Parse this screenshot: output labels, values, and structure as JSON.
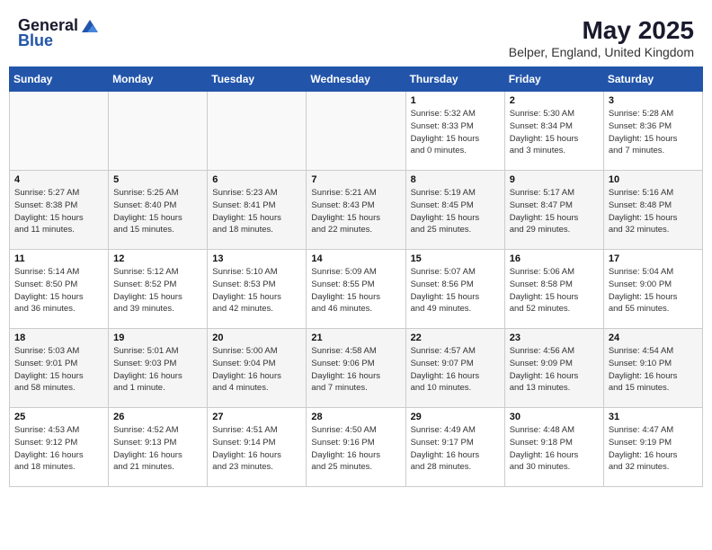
{
  "logo": {
    "general": "General",
    "blue": "Blue"
  },
  "title": "May 2025",
  "location": "Belper, England, United Kingdom",
  "days_of_week": [
    "Sunday",
    "Monday",
    "Tuesday",
    "Wednesday",
    "Thursday",
    "Friday",
    "Saturday"
  ],
  "weeks": [
    [
      {
        "day": "",
        "info": ""
      },
      {
        "day": "",
        "info": ""
      },
      {
        "day": "",
        "info": ""
      },
      {
        "day": "",
        "info": ""
      },
      {
        "day": "1",
        "info": "Sunrise: 5:32 AM\nSunset: 8:33 PM\nDaylight: 15 hours\nand 0 minutes."
      },
      {
        "day": "2",
        "info": "Sunrise: 5:30 AM\nSunset: 8:34 PM\nDaylight: 15 hours\nand 3 minutes."
      },
      {
        "day": "3",
        "info": "Sunrise: 5:28 AM\nSunset: 8:36 PM\nDaylight: 15 hours\nand 7 minutes."
      }
    ],
    [
      {
        "day": "4",
        "info": "Sunrise: 5:27 AM\nSunset: 8:38 PM\nDaylight: 15 hours\nand 11 minutes."
      },
      {
        "day": "5",
        "info": "Sunrise: 5:25 AM\nSunset: 8:40 PM\nDaylight: 15 hours\nand 15 minutes."
      },
      {
        "day": "6",
        "info": "Sunrise: 5:23 AM\nSunset: 8:41 PM\nDaylight: 15 hours\nand 18 minutes."
      },
      {
        "day": "7",
        "info": "Sunrise: 5:21 AM\nSunset: 8:43 PM\nDaylight: 15 hours\nand 22 minutes."
      },
      {
        "day": "8",
        "info": "Sunrise: 5:19 AM\nSunset: 8:45 PM\nDaylight: 15 hours\nand 25 minutes."
      },
      {
        "day": "9",
        "info": "Sunrise: 5:17 AM\nSunset: 8:47 PM\nDaylight: 15 hours\nand 29 minutes."
      },
      {
        "day": "10",
        "info": "Sunrise: 5:16 AM\nSunset: 8:48 PM\nDaylight: 15 hours\nand 32 minutes."
      }
    ],
    [
      {
        "day": "11",
        "info": "Sunrise: 5:14 AM\nSunset: 8:50 PM\nDaylight: 15 hours\nand 36 minutes."
      },
      {
        "day": "12",
        "info": "Sunrise: 5:12 AM\nSunset: 8:52 PM\nDaylight: 15 hours\nand 39 minutes."
      },
      {
        "day": "13",
        "info": "Sunrise: 5:10 AM\nSunset: 8:53 PM\nDaylight: 15 hours\nand 42 minutes."
      },
      {
        "day": "14",
        "info": "Sunrise: 5:09 AM\nSunset: 8:55 PM\nDaylight: 15 hours\nand 46 minutes."
      },
      {
        "day": "15",
        "info": "Sunrise: 5:07 AM\nSunset: 8:56 PM\nDaylight: 15 hours\nand 49 minutes."
      },
      {
        "day": "16",
        "info": "Sunrise: 5:06 AM\nSunset: 8:58 PM\nDaylight: 15 hours\nand 52 minutes."
      },
      {
        "day": "17",
        "info": "Sunrise: 5:04 AM\nSunset: 9:00 PM\nDaylight: 15 hours\nand 55 minutes."
      }
    ],
    [
      {
        "day": "18",
        "info": "Sunrise: 5:03 AM\nSunset: 9:01 PM\nDaylight: 15 hours\nand 58 minutes."
      },
      {
        "day": "19",
        "info": "Sunrise: 5:01 AM\nSunset: 9:03 PM\nDaylight: 16 hours\nand 1 minute."
      },
      {
        "day": "20",
        "info": "Sunrise: 5:00 AM\nSunset: 9:04 PM\nDaylight: 16 hours\nand 4 minutes."
      },
      {
        "day": "21",
        "info": "Sunrise: 4:58 AM\nSunset: 9:06 PM\nDaylight: 16 hours\nand 7 minutes."
      },
      {
        "day": "22",
        "info": "Sunrise: 4:57 AM\nSunset: 9:07 PM\nDaylight: 16 hours\nand 10 minutes."
      },
      {
        "day": "23",
        "info": "Sunrise: 4:56 AM\nSunset: 9:09 PM\nDaylight: 16 hours\nand 13 minutes."
      },
      {
        "day": "24",
        "info": "Sunrise: 4:54 AM\nSunset: 9:10 PM\nDaylight: 16 hours\nand 15 minutes."
      }
    ],
    [
      {
        "day": "25",
        "info": "Sunrise: 4:53 AM\nSunset: 9:12 PM\nDaylight: 16 hours\nand 18 minutes."
      },
      {
        "day": "26",
        "info": "Sunrise: 4:52 AM\nSunset: 9:13 PM\nDaylight: 16 hours\nand 21 minutes."
      },
      {
        "day": "27",
        "info": "Sunrise: 4:51 AM\nSunset: 9:14 PM\nDaylight: 16 hours\nand 23 minutes."
      },
      {
        "day": "28",
        "info": "Sunrise: 4:50 AM\nSunset: 9:16 PM\nDaylight: 16 hours\nand 25 minutes."
      },
      {
        "day": "29",
        "info": "Sunrise: 4:49 AM\nSunset: 9:17 PM\nDaylight: 16 hours\nand 28 minutes."
      },
      {
        "day": "30",
        "info": "Sunrise: 4:48 AM\nSunset: 9:18 PM\nDaylight: 16 hours\nand 30 minutes."
      },
      {
        "day": "31",
        "info": "Sunrise: 4:47 AM\nSunset: 9:19 PM\nDaylight: 16 hours\nand 32 minutes."
      }
    ]
  ]
}
